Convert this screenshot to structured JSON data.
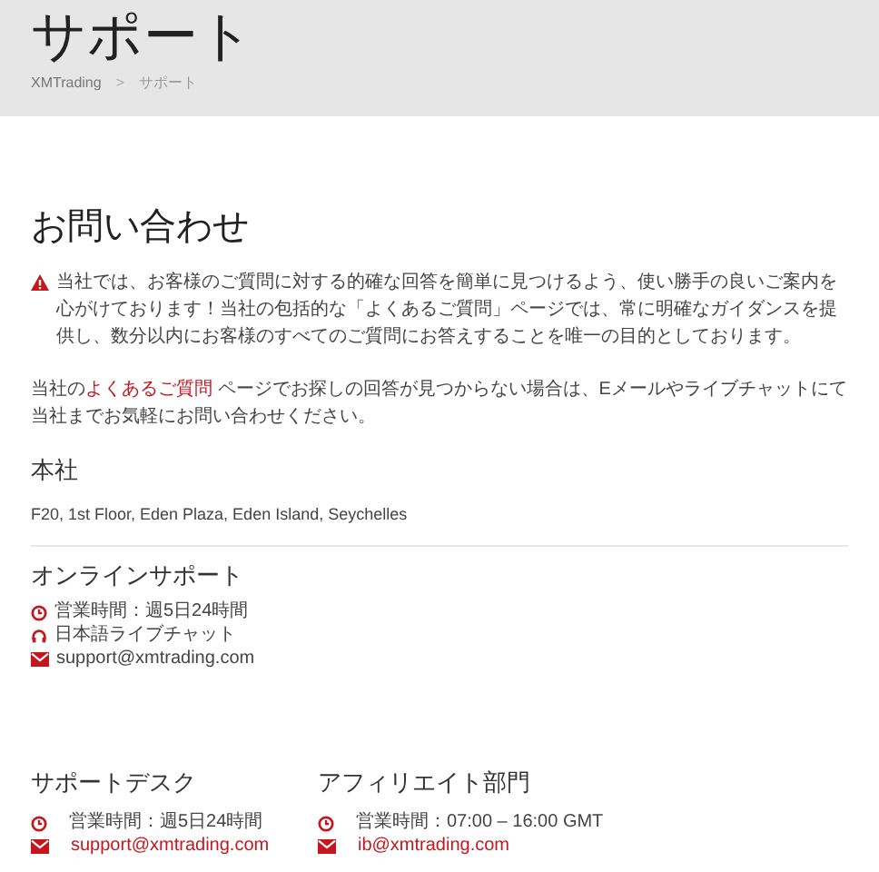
{
  "header": {
    "title": "サポート",
    "breadcrumb": [
      {
        "label": "XMTrading",
        "kind": "link"
      },
      {
        "label": ">",
        "kind": "separator"
      },
      {
        "label": "サポート",
        "kind": "current"
      }
    ]
  },
  "contact": {
    "title": "お問い合わせ",
    "intro": "当社では、お客様のご質問に対する的確な回答を簡単に見つけるよう、使い勝手の良いご案内を心がけております！当社の包括的な「よくあるご質問」ページでは、常に明確なガイダンスを提供し、数分以内にお客様のすべてのご質問にお答えすることを唯一の目的としております。",
    "faq_before": "当社の",
    "faq_link": "よくあるご質問",
    "faq_after": " ページでお探しの回答が見つからない場合は、Eメールやライブチャットにて当社までお気軽にお問い合わせください。"
  },
  "head_office": {
    "title": "本社",
    "address": "F20, 1st Floor, Eden Plaza, Eden Island, Seychelles"
  },
  "online_support": {
    "title": "オンラインサポート",
    "items": [
      {
        "kind": "clock",
        "text": "営業時間：週5日24時間",
        "link": false
      },
      {
        "kind": "headset",
        "text": "日本語ライブチャット",
        "link": false
      },
      {
        "kind": "mail",
        "text": "support@xmtrading.com",
        "link": false
      }
    ]
  },
  "departments": [
    {
      "title": "サポートデスク",
      "items": [
        {
          "kind": "clock",
          "text": "営業時間：週5日24時間",
          "link": false
        },
        {
          "kind": "mail",
          "text": "support@xmtrading.com",
          "link": true
        }
      ]
    },
    {
      "title": "アフィリエイト部門",
      "items": [
        {
          "kind": "clock",
          "text": "営業時間：07:00 – 16:00 GMT",
          "link": false
        },
        {
          "kind": "mail",
          "text": "ib@xmtrading.com",
          "link": true
        }
      ]
    }
  ]
}
